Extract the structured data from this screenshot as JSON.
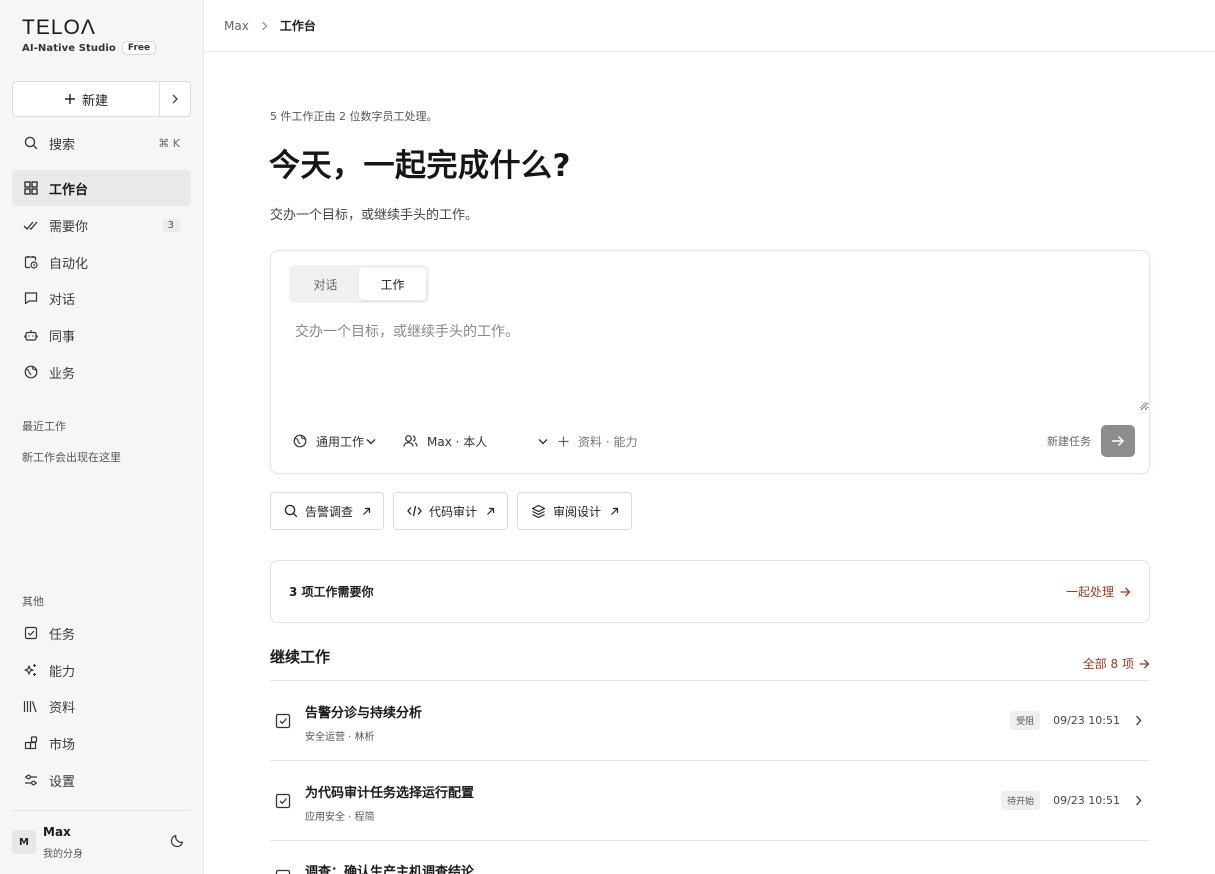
{
  "brand": {
    "logo": "TELOΛ",
    "tagline": "AI-Native Studio",
    "plan": "Free"
  },
  "sidebar": {
    "new_button": "新建",
    "search": {
      "label": "搜索",
      "shortcut": "⌘ K"
    },
    "items": [
      {
        "label": "工作台",
        "icon": "grid-icon",
        "active": true
      },
      {
        "label": "需要你",
        "icon": "double-check-icon",
        "count": "3"
      },
      {
        "label": "自动化",
        "icon": "calendar-clock-icon"
      },
      {
        "label": "对话",
        "icon": "chat-icon"
      },
      {
        "label": "同事",
        "icon": "bot-icon"
      },
      {
        "label": "业务",
        "icon": "globe-icon"
      }
    ],
    "recent_label": "最近工作",
    "recent_empty": "新工作会出现在这里",
    "other_label": "其他",
    "other_items": [
      {
        "label": "任务",
        "icon": "checkbox-icon"
      },
      {
        "label": "能力",
        "icon": "sparkle-icon"
      },
      {
        "label": "资料",
        "icon": "library-icon"
      },
      {
        "label": "市场",
        "icon": "blocks-icon"
      },
      {
        "label": "设置",
        "icon": "sliders-icon"
      }
    ],
    "user": {
      "initial": "M",
      "name": "Max",
      "subtitle": "我的分身"
    }
  },
  "breadcrumb": {
    "root": "Max",
    "current": "工作台"
  },
  "main": {
    "status_line": "5 件工作正由 2 位数字员工处理。",
    "hero_title": "今天，一起完成什么?",
    "hero_subtitle": "交办一个目标，或继续手头的工作。",
    "composer": {
      "tabs": [
        "对话",
        "工作"
      ],
      "active_tab": "工作",
      "placeholder": "交办一个目标，或继续手头的工作。",
      "work_type": "通用工作",
      "agent": "Max · 本人",
      "attach": "资料 · 能力",
      "new_task": "新建任务"
    },
    "quick_actions": [
      {
        "label": "告警调查",
        "icon": "search-icon"
      },
      {
        "label": "代码审计",
        "icon": "code-icon"
      },
      {
        "label": "审阅设计",
        "icon": "layers-icon"
      }
    ],
    "needs_you": {
      "title": "3 项工作需要你",
      "action": "一起处理"
    },
    "continue": {
      "title": "继续工作",
      "all_link": "全部 8 项",
      "rows": [
        {
          "title": "告警分诊与持续分析",
          "meta": "安全运营 · 林析",
          "status": "受阻",
          "time": "09/23 10:51"
        },
        {
          "title": "为代码审计任务选择运行配置",
          "meta": "应用安全 · 程简",
          "status": "待开始",
          "time": "09/23 10:51"
        },
        {
          "title": "调查：确认生产主机调查结论",
          "meta": "",
          "status": "",
          "time": ""
        }
      ]
    }
  },
  "colors": {
    "accent": "#9a3b1e",
    "active_nav_bg": "#e9e9e7",
    "sidebar_bg": "#f6f6f5",
    "send_button": "#8d8d8b"
  }
}
